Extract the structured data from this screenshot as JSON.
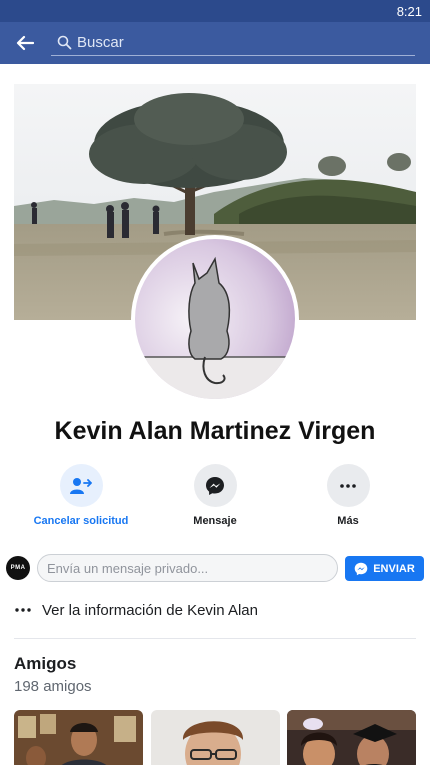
{
  "status_bar": {
    "time": "8:21"
  },
  "search": {
    "placeholder": "Buscar"
  },
  "profile": {
    "name": "Kevin Alan Martinez Virgen"
  },
  "actions": [
    {
      "label": "Cancelar solicitud",
      "icon": "person-arrow-icon"
    },
    {
      "label": "Mensaje",
      "icon": "messenger-icon"
    },
    {
      "label": "Más",
      "icon": "more-dots-icon"
    }
  ],
  "message_bar": {
    "placeholder": "Envía un mensaje privado...",
    "send_label": "ENVIAR",
    "page_logo_text": "PMA"
  },
  "info_link": {
    "label": "Ver la información de Kevin Alan"
  },
  "friends": {
    "title": "Amigos",
    "count": "198 amigos"
  },
  "colors": {
    "app_bar": "#3b5a9f",
    "status_bar": "#2c4a8c",
    "accent": "#1877f2"
  }
}
